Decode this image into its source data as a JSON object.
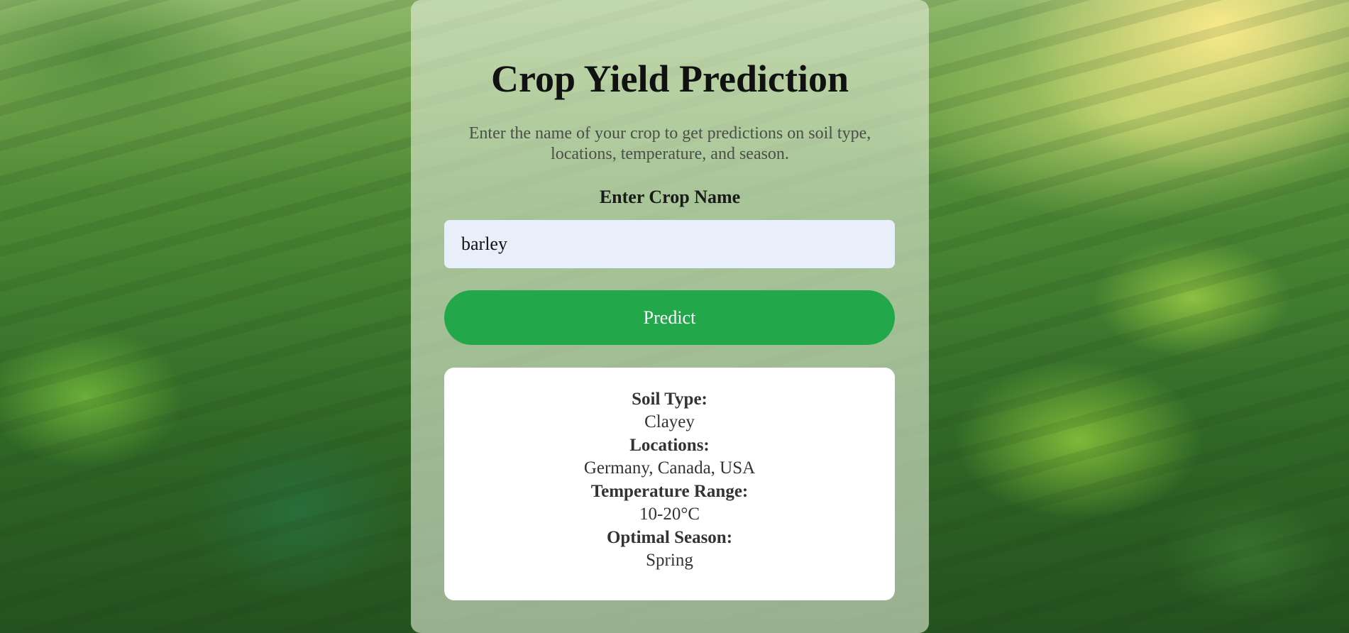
{
  "page": {
    "title": "Crop Yield Prediction",
    "subtitle": "Enter the name of your crop to get predictions on soil type, locations, temperature, and season."
  },
  "form": {
    "label": "Enter Crop Name",
    "input_value": "barley",
    "button_label": "Predict"
  },
  "results": {
    "soil_type": {
      "label": "Soil Type:",
      "value": "Clayey"
    },
    "locations": {
      "label": "Locations:",
      "value": "Germany, Canada, USA"
    },
    "temperature": {
      "label": "Temperature Range:",
      "value": "10-20°C"
    },
    "season": {
      "label": "Optimal Season:",
      "value": "Spring"
    }
  },
  "colors": {
    "button": "#22a84a",
    "input_background": "#e8effb",
    "card_background": "#ffffff"
  }
}
